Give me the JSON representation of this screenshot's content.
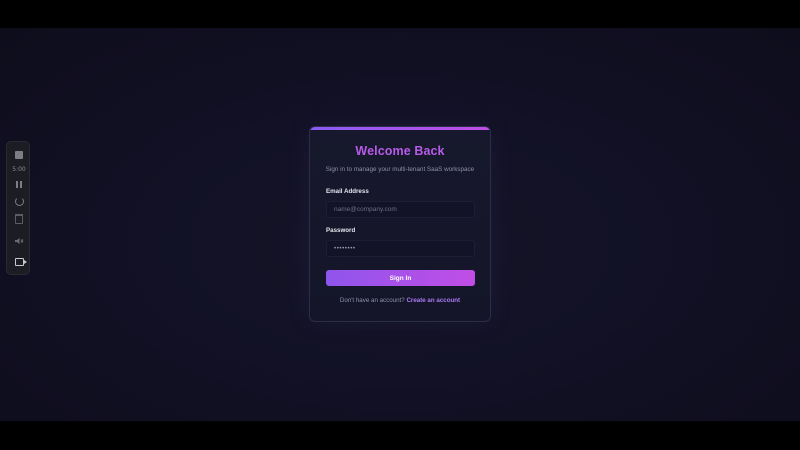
{
  "toolbar": {
    "timer": "5:00",
    "icons": [
      "stop-icon",
      "pause-icon",
      "restart-icon",
      "trash-icon",
      "mute-icon",
      "camera-icon"
    ]
  },
  "login": {
    "title": "Welcome Back",
    "subtitle": "Sign in to manage your multi-tenant SaaS workspace",
    "email_label": "Email Address",
    "email_placeholder": "name@company.com",
    "email_value": "",
    "password_label": "Password",
    "password_value": "••••••••",
    "signin_label": "Sign In",
    "signup_prompt": "Don't have an account?",
    "signup_link": "Create an account"
  },
  "colors": {
    "accent_start": "#8b5cf6",
    "accent_end": "#c04ee4",
    "title": "#b65ce8",
    "background": "#121125",
    "card": "#17182d"
  }
}
